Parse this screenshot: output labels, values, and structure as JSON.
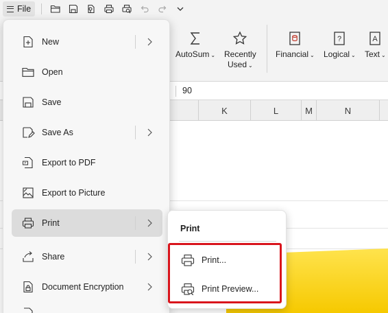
{
  "toolbar": {
    "file_label": "File",
    "icons": [
      "open-folder-icon",
      "save-icon",
      "export-pdf-icon",
      "print-icon",
      "print-preview-icon",
      "undo-icon",
      "redo-icon",
      "customize-dropdown-icon"
    ]
  },
  "ribbon": {
    "autosum_label": "AutoSum",
    "recently_used_label_1": "Recently",
    "recently_used_label_2": "Used",
    "financial_label": "Financial",
    "logical_label": "Logical",
    "text_label": "Text"
  },
  "formula_bar": {
    "value": "90"
  },
  "columns": [
    "K",
    "L",
    "M",
    "N"
  ],
  "file_menu": {
    "items": [
      {
        "label": "New",
        "icon": "new-document-icon",
        "has_submenu": true
      },
      {
        "label": "Open",
        "icon": "folder-icon",
        "has_submenu": false
      },
      {
        "label": "Save",
        "icon": "save-icon",
        "has_submenu": false
      },
      {
        "label": "Save As",
        "icon": "save-as-icon",
        "has_submenu": true
      },
      {
        "label": "Export to PDF",
        "icon": "export-pdf-icon",
        "has_submenu": false
      },
      {
        "label": "Export to Picture",
        "icon": "export-picture-icon",
        "has_submenu": false
      },
      {
        "label": "Print",
        "icon": "printer-icon",
        "has_submenu": true,
        "active": true
      },
      {
        "label": "Share",
        "icon": "share-icon",
        "has_submenu": true
      },
      {
        "label": "Document Encryption",
        "icon": "document-encryption-icon",
        "has_submenu": true
      }
    ]
  },
  "print_submenu": {
    "title": "Print",
    "items": [
      {
        "label": "Print...",
        "icon": "printer-icon"
      },
      {
        "label": "Print Preview...",
        "icon": "print-preview-icon"
      }
    ]
  },
  "colors": {
    "highlight": "#d9141c",
    "active_item_bg": "#dcdcdc",
    "shape_fill": "#f6c900"
  }
}
